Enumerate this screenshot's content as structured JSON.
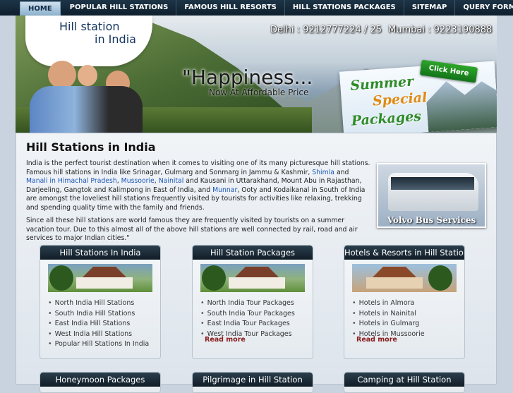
{
  "nav": {
    "items": [
      "HOME",
      "POPULAR HILL STATIONS",
      "FAMOUS HILL RESORTS",
      "HILL STATIONS PACKAGES",
      "SITEMAP",
      "QUERY FORM"
    ]
  },
  "banner": {
    "logo_line1": "Hill station",
    "logo_line2": "in India",
    "phone_delhi": "Delhi : 9212777224 / 25",
    "phone_mumbai": "Mumbai : 9223190888",
    "tagline": "\"Happiness...",
    "subtagline": "Now At Affordable Price",
    "promo_line1": "Summer",
    "promo_line2": "Special",
    "promo_line3": "Packages",
    "click_here": "Click Here"
  },
  "main": {
    "title": "Hill Stations in India",
    "p1_a": "India is the perfect tourist destination when it comes to visiting one of its many picturesque hill stations. Famous hill stations in India like Srinagar, Gulmarg and Sonmarg in Jammu & Kashmir, ",
    "link_shimla": "Shimla",
    "and1": " and ",
    "link_manali": "Manali in Himachal Pradesh",
    "comma1": ", ",
    "link_mussoorie": "Mussoorie",
    "comma2": ", ",
    "link_nainital": "Nainital",
    "p1_b": " and Kausani in Uttarakhand, Mount Abu in Rajasthan, Darjeeling, Gangtok and Kalimpong in East of India, and ",
    "link_munnar": "Munnar",
    "p1_c": ", Ooty and Kodaikanal in South of India are amongst the loveliest hill stations frequently visited by tourists for activities like relaxing, trekking and spending quality time with the family and friends.",
    "p2": "Since all these hill stations are world famous they are frequently visited by tourists on a summer vacation tour. Due to this almost all of the above hill stations are well connected by rail, road and air services to major Indian cities.\"",
    "bus_title": "Volvo Bus Services"
  },
  "boxes": [
    {
      "title": "Hill Stations In India",
      "items": [
        "North India Hill Stations",
        "South India Hill Stations",
        "East India Hill Stations",
        "West India Hill Stations",
        "Popular Hill Stations In India"
      ],
      "read_more": ""
    },
    {
      "title": "Hill Station Packages",
      "items": [
        "North India Tour Packages",
        "South India Tour Packages",
        "East India Tour Packages",
        "West India Tour Packages"
      ],
      "read_more": "Read more"
    },
    {
      "title": "Hotels & Resorts in Hill Station",
      "items": [
        "Hotels in Almora",
        "Hotels in Nainital",
        "Hotels in Gulmarg",
        "Hotels in Mussoorie"
      ],
      "read_more": "Read more"
    },
    {
      "title": "Honeymoon Packages"
    },
    {
      "title": "Pilgrimage in Hill Station"
    },
    {
      "title": "Camping at Hill Station"
    }
  ]
}
